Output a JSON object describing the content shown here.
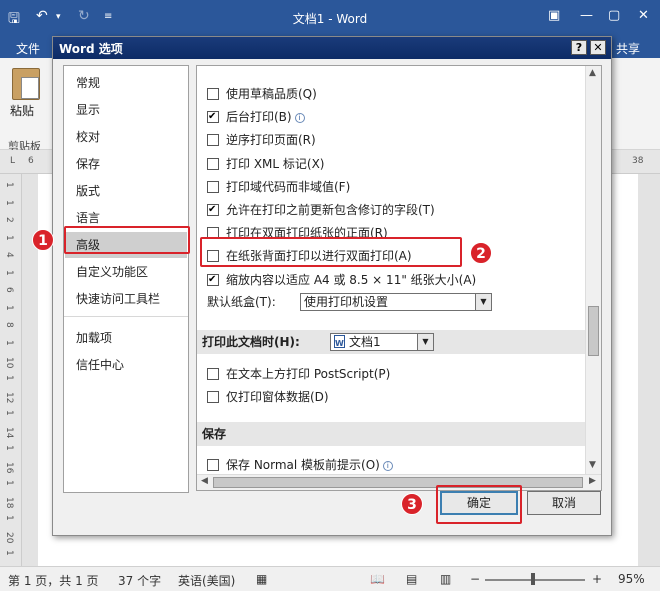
{
  "app": {
    "title": "文档1 - Word",
    "tabs": {
      "file": "文件",
      "share": "共享"
    },
    "ribbon": {
      "paste": "粘贴",
      "clipboard": "剪贴板"
    }
  },
  "ruler": {
    "h_right": "38",
    "h_left": "6",
    "v_nums": [
      "1",
      "1",
      "2",
      "1",
      "4",
      "1",
      "6",
      "1",
      "8",
      "1",
      "10",
      "1",
      "12",
      "1",
      "14",
      "1",
      "16",
      "1",
      "18",
      "1",
      "20",
      "1"
    ]
  },
  "dialog": {
    "title": "Word 选项",
    "help": "?",
    "close": "✕",
    "nav": [
      "常规",
      "显示",
      "校对",
      "保存",
      "版式",
      "语言",
      "高级",
      "自定义功能区",
      "快速访问工具栏",
      "加载项",
      "信任中心"
    ],
    "selected_nav": "高级",
    "print_options": [
      {
        "label": "使用草稿品质(Q)",
        "checked": false
      },
      {
        "label": "后台打印(B)",
        "checked": true,
        "info": true
      },
      {
        "label": "逆序打印页面(R)",
        "checked": false
      },
      {
        "label": "打印 XML 标记(X)",
        "checked": false
      },
      {
        "label": "打印域代码而非域值(F)",
        "checked": false
      },
      {
        "label": "允许在打印之前更新包含修订的字段(T)",
        "checked": true
      },
      {
        "label": "打印在双面打印纸张的正面(R)",
        "checked": false
      },
      {
        "label": "在纸张背面打印以进行双面打印(A)",
        "checked": false
      },
      {
        "label": "缩放内容以适应 A4 或 8.5 × 11\" 纸张大小(A)",
        "checked": true
      }
    ],
    "default_tray": {
      "label": "默认纸盒(T):",
      "value": "使用打印机设置"
    },
    "print_doc_section": {
      "label": "打印此文档时(H):",
      "value": "文档1"
    },
    "doc_options": [
      {
        "label": "在文本上方打印 PostScript(P)",
        "checked": false
      },
      {
        "label": "仅打印窗体数据(D)",
        "checked": false
      }
    ],
    "save_section": "保存",
    "save_options": [
      {
        "label": "保存 Normal 模板前提示(O)",
        "checked": false,
        "info": true
      }
    ],
    "ok": "确定",
    "cancel": "取消"
  },
  "annotations": {
    "m1": "1",
    "m2": "2",
    "m3": "3",
    "color": "#d9232a"
  },
  "status": {
    "page": "第 1 页，共 1 页",
    "words": "37 个字",
    "lang": "英语(美国)",
    "zoom": "95%"
  }
}
